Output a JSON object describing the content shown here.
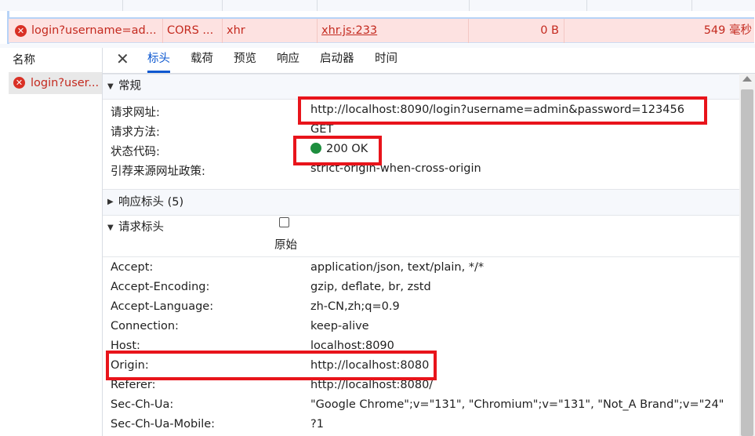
{
  "request": {
    "name": "login?username=ad...",
    "type": "CORS ...",
    "initiator_kind": "xhr",
    "initiator": "xhr.js:233",
    "size": "0 B",
    "time": "549 毫秒"
  },
  "name_column": {
    "header": "名称",
    "item": "login?user..."
  },
  "tabs": [
    {
      "label": "标头",
      "active": true
    },
    {
      "label": "载荷"
    },
    {
      "label": "预览"
    },
    {
      "label": "响应"
    },
    {
      "label": "启动器"
    },
    {
      "label": "时间"
    }
  ],
  "general": {
    "title": "常规",
    "rows": [
      {
        "key": "请求网址:",
        "value": "http://localhost:8090/login?username=admin&password=123456"
      },
      {
        "key": "请求方法:",
        "value": "GET"
      },
      {
        "key": "状态代码:",
        "value": "200 OK"
      },
      {
        "key": "引荐来源网址政策:",
        "value": "strict-origin-when-cross-origin"
      }
    ]
  },
  "response_headers": {
    "title": "响应标头 (5)"
  },
  "request_headers": {
    "title": "请求标头",
    "raw_label": "原始",
    "rows": [
      {
        "key": "Accept:",
        "value": "application/json, text/plain, */*"
      },
      {
        "key": "Accept-Encoding:",
        "value": "gzip, deflate, br, zstd"
      },
      {
        "key": "Accept-Language:",
        "value": "zh-CN,zh;q=0.9"
      },
      {
        "key": "Connection:",
        "value": "keep-alive"
      },
      {
        "key": "Host:",
        "value": "localhost:8090"
      },
      {
        "key": "Origin:",
        "value": "http://localhost:8080"
      },
      {
        "key": "Referer:",
        "value": "http://localhost:8080/"
      },
      {
        "key": "Sec-Ch-Ua:",
        "value": "\"Google Chrome\";v=\"131\", \"Chromium\";v=\"131\", \"Not_A Brand\";v=\"24\""
      },
      {
        "key": "Sec-Ch-Ua-Mobile:",
        "value": "?1"
      }
    ]
  },
  "icons": {
    "error": "error-circle-icon",
    "close": "close-icon",
    "status": "status-green-dot-icon"
  },
  "colors": {
    "error_text": "#c42a1f",
    "active_tab": "#0b57d0",
    "status_ok": "#1e8e3e",
    "annotation": "#e8141b"
  }
}
